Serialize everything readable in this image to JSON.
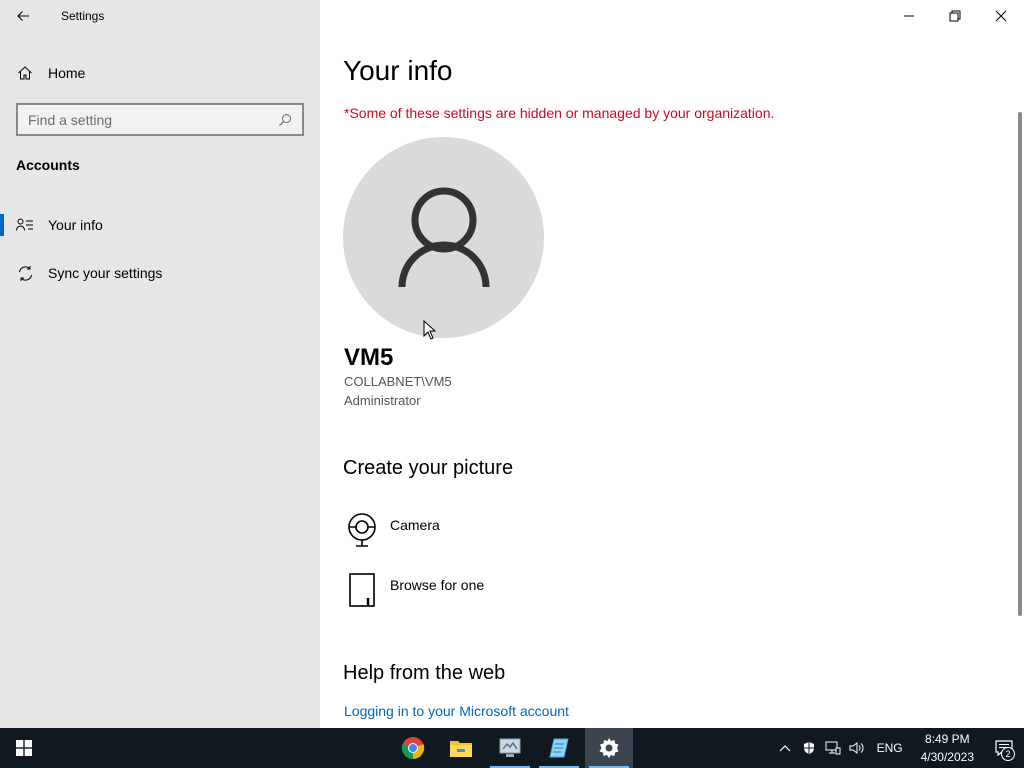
{
  "window": {
    "app_title": "Settings",
    "controls": {
      "minimize_icon": "minimize-icon",
      "restore_icon": "restore-icon",
      "close_icon": "close-icon"
    }
  },
  "sidebar": {
    "home_label": "Home",
    "search": {
      "placeholder": "Find a setting",
      "value": ""
    },
    "section_heading": "Accounts",
    "items": [
      {
        "label": "Your info",
        "icon": "person-list-icon",
        "selected": true
      },
      {
        "label": "Sync your settings",
        "icon": "sync-icon",
        "selected": false
      }
    ]
  },
  "main": {
    "page_title": "Your info",
    "org_notice": "*Some of these settings are hidden or managed by your organization.",
    "user": {
      "name": "VM5",
      "domain_account": "COLLABNET\\VM5",
      "role": "Administrator"
    },
    "create_picture": {
      "title": "Create your picture",
      "options": [
        {
          "label": "Camera",
          "icon": "camera-icon"
        },
        {
          "label": "Browse for one",
          "icon": "browse-file-icon"
        }
      ]
    },
    "help": {
      "title": "Help from the web",
      "link_label": "Logging in to your Microsoft account"
    }
  },
  "taskbar": {
    "apps": [
      "chrome-icon",
      "file-explorer-icon",
      "server-manager-icon",
      "notepad-icon",
      "settings-gear-icon"
    ],
    "language": "ENG",
    "time": "8:49 PM",
    "date": "4/30/2023",
    "notification_count": "2"
  },
  "colors": {
    "sidebar_bg": "#e6e6e6",
    "accent": "#0067c0",
    "warning_text": "#c50f1f",
    "link": "#0067b8",
    "taskbar_bg": "#101820"
  }
}
